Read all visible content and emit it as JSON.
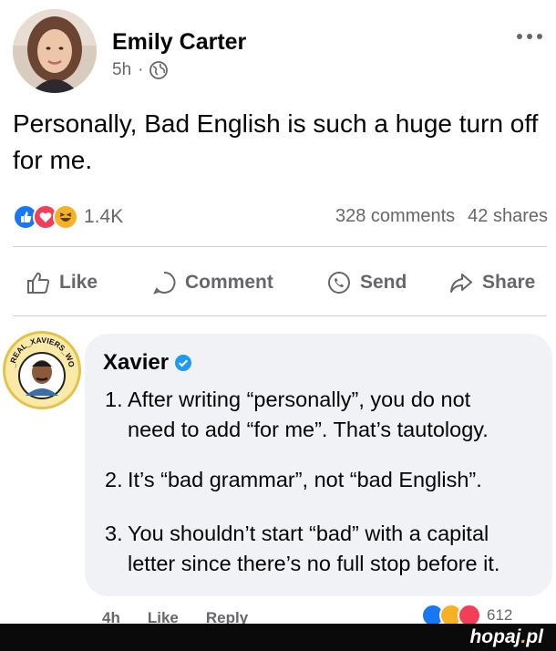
{
  "post": {
    "author": "Emily Carter",
    "time": "5h",
    "separator": "·",
    "audience_icon": "globe-icon",
    "more_icon": "ellipsis-icon",
    "text": "Personally, Bad English is such a huge turn off for me.",
    "reaction_icons": [
      "like-icon",
      "love-icon",
      "haha-icon"
    ],
    "reaction_count": "1.4K",
    "comments_count": "328 comments",
    "shares_count": "42 shares"
  },
  "actions": {
    "like": "Like",
    "comment": "Comment",
    "send": "Send",
    "share": "Share"
  },
  "comment": {
    "author": "Xavier",
    "avatar_ring_text": "THE_REAL_XAVIERS_WORLD",
    "points": [
      {
        "num": "1.",
        "line1": "After writing “personally”, you do not",
        "line2": "need to add “for me”. That’s tautology."
      },
      {
        "num": "2.",
        "line1": "It’s “bad grammar”, not “bad English”.",
        "line2": ""
      },
      {
        "num": "3.",
        "line1": "You shouldn’t start “bad” with a capital",
        "line2": "letter since there’s no full stop before it."
      }
    ],
    "footer": {
      "time": "4h",
      "like": "Like",
      "reply": "Reply"
    },
    "reaction_count": "612"
  },
  "watermark": {
    "name": "hopaj",
    "dot": ".",
    "tld": "pl"
  },
  "colors": {
    "like_blue": "#1877f2",
    "love_red": "#f33e58",
    "haha_yellow": "#f7b125",
    "verified_blue": "#1d9bf0",
    "bubble": "#f0f2f5"
  }
}
